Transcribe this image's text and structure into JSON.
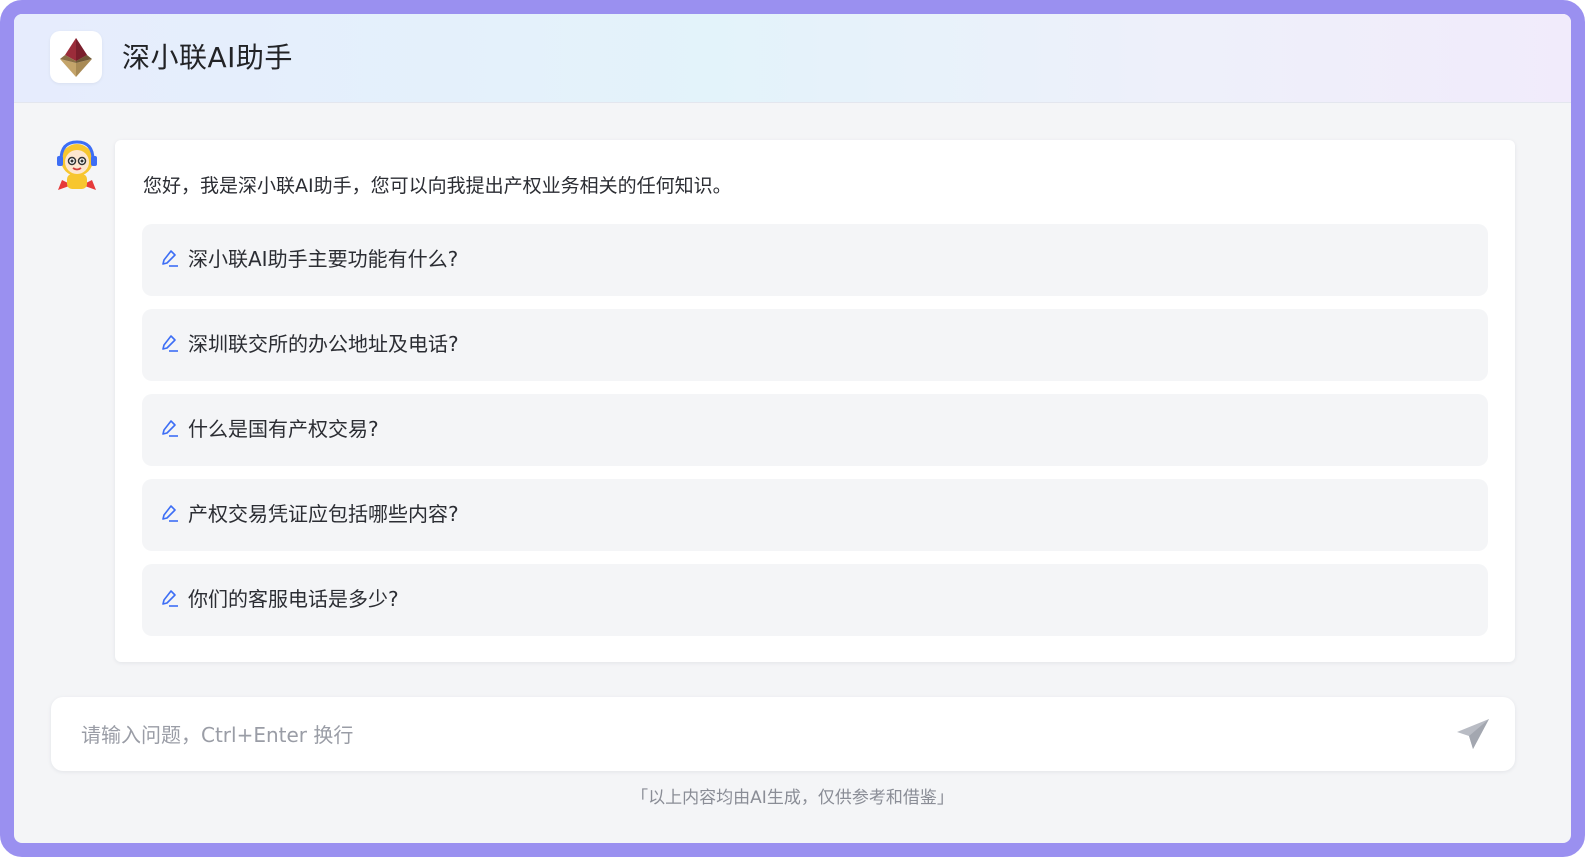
{
  "header": {
    "title": "深小联AI助手",
    "logo_icon": "diamond-logo-icon"
  },
  "chat": {
    "assistant_avatar_icon": "robot-mascot-icon",
    "greeting": "您好，我是深小联AI助手，您可以向我提出产权业务相关的任何知识。",
    "suggestions": [
      {
        "text": "深小联AI助手主要功能有什么?",
        "icon": "pen-icon"
      },
      {
        "text": "深圳联交所的办公地址及电话?",
        "icon": "pen-icon"
      },
      {
        "text": "什么是国有产权交易?",
        "icon": "pen-icon"
      },
      {
        "text": "产权交易凭证应包括哪些内容?",
        "icon": "pen-icon"
      },
      {
        "text": "你们的客服电话是多少?",
        "icon": "pen-icon"
      }
    ]
  },
  "input": {
    "placeholder": "请输入问题，Ctrl+Enter 换行",
    "value": "",
    "send_icon": "paper-plane-icon"
  },
  "footer": {
    "disclaimer": "「以上内容均由AI生成，仅供参考和借鉴」"
  },
  "colors": {
    "frame_border": "#9a90f0",
    "background": "#f4f5f7",
    "accent_blue": "#3d6ef5",
    "logo_red": "#9b2c3a",
    "logo_gold": "#b89a63"
  }
}
